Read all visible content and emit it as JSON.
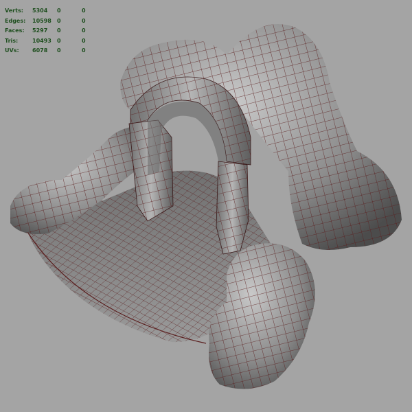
{
  "viewport": {
    "background_color": "#a4a4a4",
    "hud_color": "#1f4f1f"
  },
  "heads_up_display": {
    "rows": [
      {
        "label": "Verts:",
        "value": "5304",
        "selected": "0",
        "component": "0"
      },
      {
        "label": "Edges:",
        "value": "10598",
        "selected": "0",
        "component": "0"
      },
      {
        "label": "Faces:",
        "value": "5297",
        "selected": "0",
        "component": "0"
      },
      {
        "label": "Tris:",
        "value": "10493",
        "selected": "0",
        "component": "0"
      },
      {
        "label": "UVs:",
        "value": "6078",
        "selected": "0",
        "component": "0"
      }
    ]
  },
  "model": {
    "mesh_fill": "#8e8e8e",
    "wire_color": "#5a1d1d"
  }
}
